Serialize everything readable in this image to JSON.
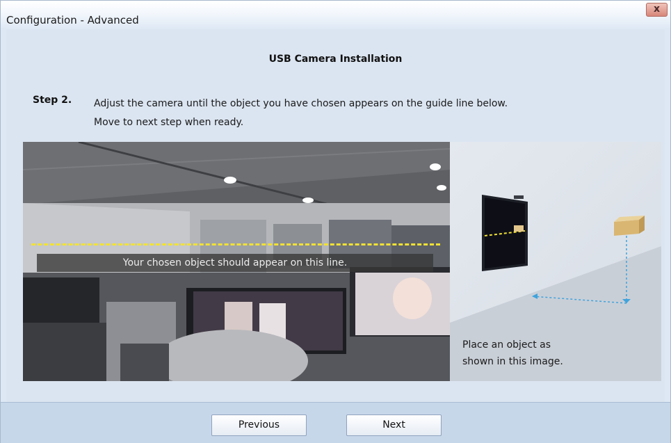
{
  "window": {
    "title": "Configuration - Advanced",
    "close_icon": "close-icon"
  },
  "page": {
    "heading": "USB Camera Installation",
    "step_label": "Step 2.",
    "step_line1": "Adjust the camera until the object you have chosen appears on the guide line below.",
    "step_line2": "Move to next step when ready."
  },
  "camera_view": {
    "caption": "Your chosen object should appear on this line.",
    "guide_line_color": "#f2e233"
  },
  "guide": {
    "text_line1": "Place an object as",
    "text_line2": "shown in this image."
  },
  "footer": {
    "previous_label": "Previous",
    "next_label": "Next"
  }
}
